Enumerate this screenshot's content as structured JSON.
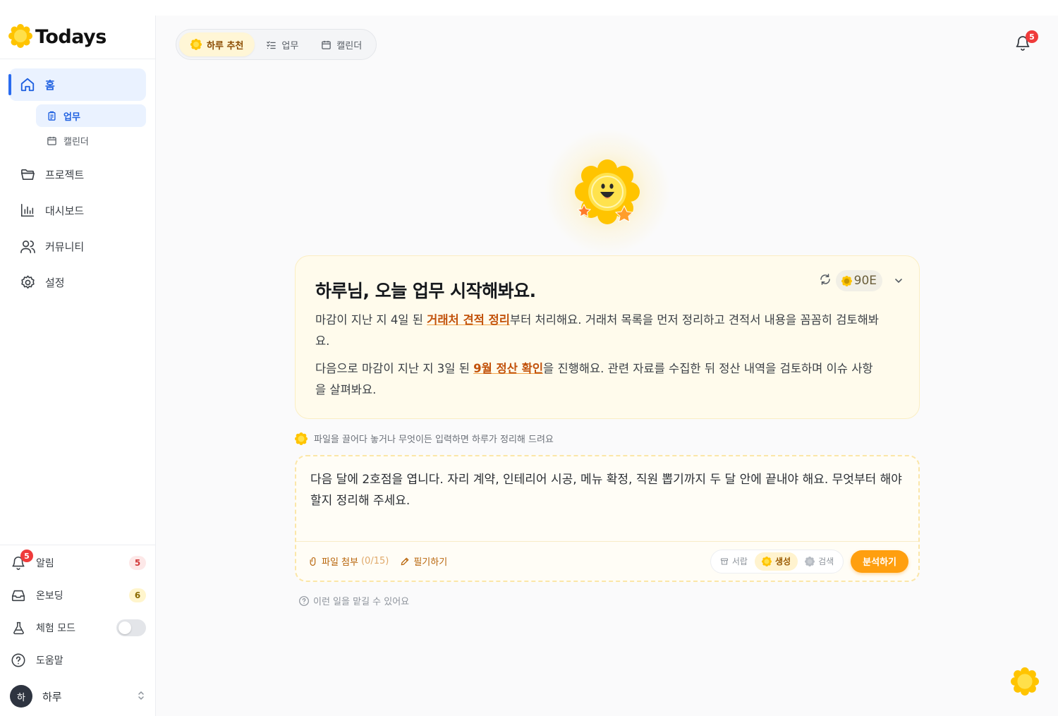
{
  "brand": {
    "name": "Todays"
  },
  "sidebar": {
    "items": [
      {
        "label": "홈"
      },
      {
        "label": "업무"
      },
      {
        "label": "캘린더"
      },
      {
        "label": "프로젝트"
      },
      {
        "label": "대시보드"
      },
      {
        "label": "커뮤니티"
      },
      {
        "label": "설정"
      }
    ],
    "bottom": {
      "alerts": {
        "label": "알림",
        "count": "5",
        "icon_badge": "5"
      },
      "onboarding": {
        "label": "온보딩",
        "count": "6"
      },
      "trial_mode": {
        "label": "체험 모드",
        "on": false
      },
      "help": {
        "label": "도움말"
      },
      "user": {
        "avatar": "하",
        "name": "하루"
      }
    }
  },
  "header": {
    "tabs": [
      {
        "label": "하루 추천",
        "icon": "sun-icon"
      },
      {
        "label": "업무",
        "icon": "checklist-icon"
      },
      {
        "label": "캘린더",
        "icon": "calendar-icon"
      }
    ],
    "bell_badge": "5"
  },
  "card": {
    "title": "하루님, 오늘 업무 시작해봐요.",
    "token": "90E",
    "p1_before": "마감이 지난 지 4일 된 ",
    "p1_link": "거래처 견적 정리",
    "p1_after": "부터 처리해요. 거래처 목록을 먼저 정리하고 견적서 내용을 꼼꼼히 검토해봐요.",
    "p2_before": "다음으로 마감이 지난 지 3일 된 ",
    "p2_link": "9월 정산 확인",
    "p2_after": "을 진행해요. 관련 자료를 수집한 뒤 정산 내역을 검토하며 이슈 사항을 살펴봐요."
  },
  "hint": "파일을 끌어다 놓거나 무엇이든 입력하면 하루가 정리해 드려요",
  "input": {
    "text": "다음 달에 2호점을 엽니다. 자리 계약, 인테리어 시공, 메뉴 확정, 직원 뽑기까지 두 달 안에 끝내야 해요. 무엇부터 해야 할지 정리해 주세요.",
    "attach_label": "파일 첨부",
    "attach_count": "(0/15)",
    "write_label": "필기하기",
    "modes": [
      {
        "label": "서랍"
      },
      {
        "label": "생성"
      },
      {
        "label": "검색"
      }
    ],
    "submit_label": "분석하기"
  },
  "sub_hint": "이런 일을 맡길 수 있어요",
  "colors": {
    "accent": "#ff9f0f",
    "primary": "#2a6cf0",
    "alert": "#ef3b3b"
  }
}
